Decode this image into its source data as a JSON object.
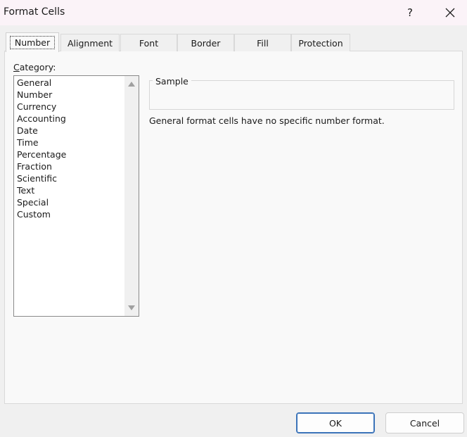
{
  "window": {
    "title": "Format Cells",
    "help_label": "?"
  },
  "tabs": [
    {
      "label": "Number",
      "active": true
    },
    {
      "label": "Alignment",
      "active": false
    },
    {
      "label": "Font",
      "active": false
    },
    {
      "label": "Border",
      "active": false
    },
    {
      "label": "Fill",
      "active": false
    },
    {
      "label": "Protection",
      "active": false
    }
  ],
  "category": {
    "label_first": "C",
    "label_rest": "ategory:",
    "items": [
      "General",
      "Number",
      "Currency",
      "Accounting",
      "Date",
      "Time",
      "Percentage",
      "Fraction",
      "Scientific",
      "Text",
      "Special",
      "Custom"
    ]
  },
  "sample": {
    "legend": "Sample",
    "value": ""
  },
  "description": "General format cells have no specific number format.",
  "buttons": {
    "ok": "OK",
    "cancel": "Cancel"
  }
}
